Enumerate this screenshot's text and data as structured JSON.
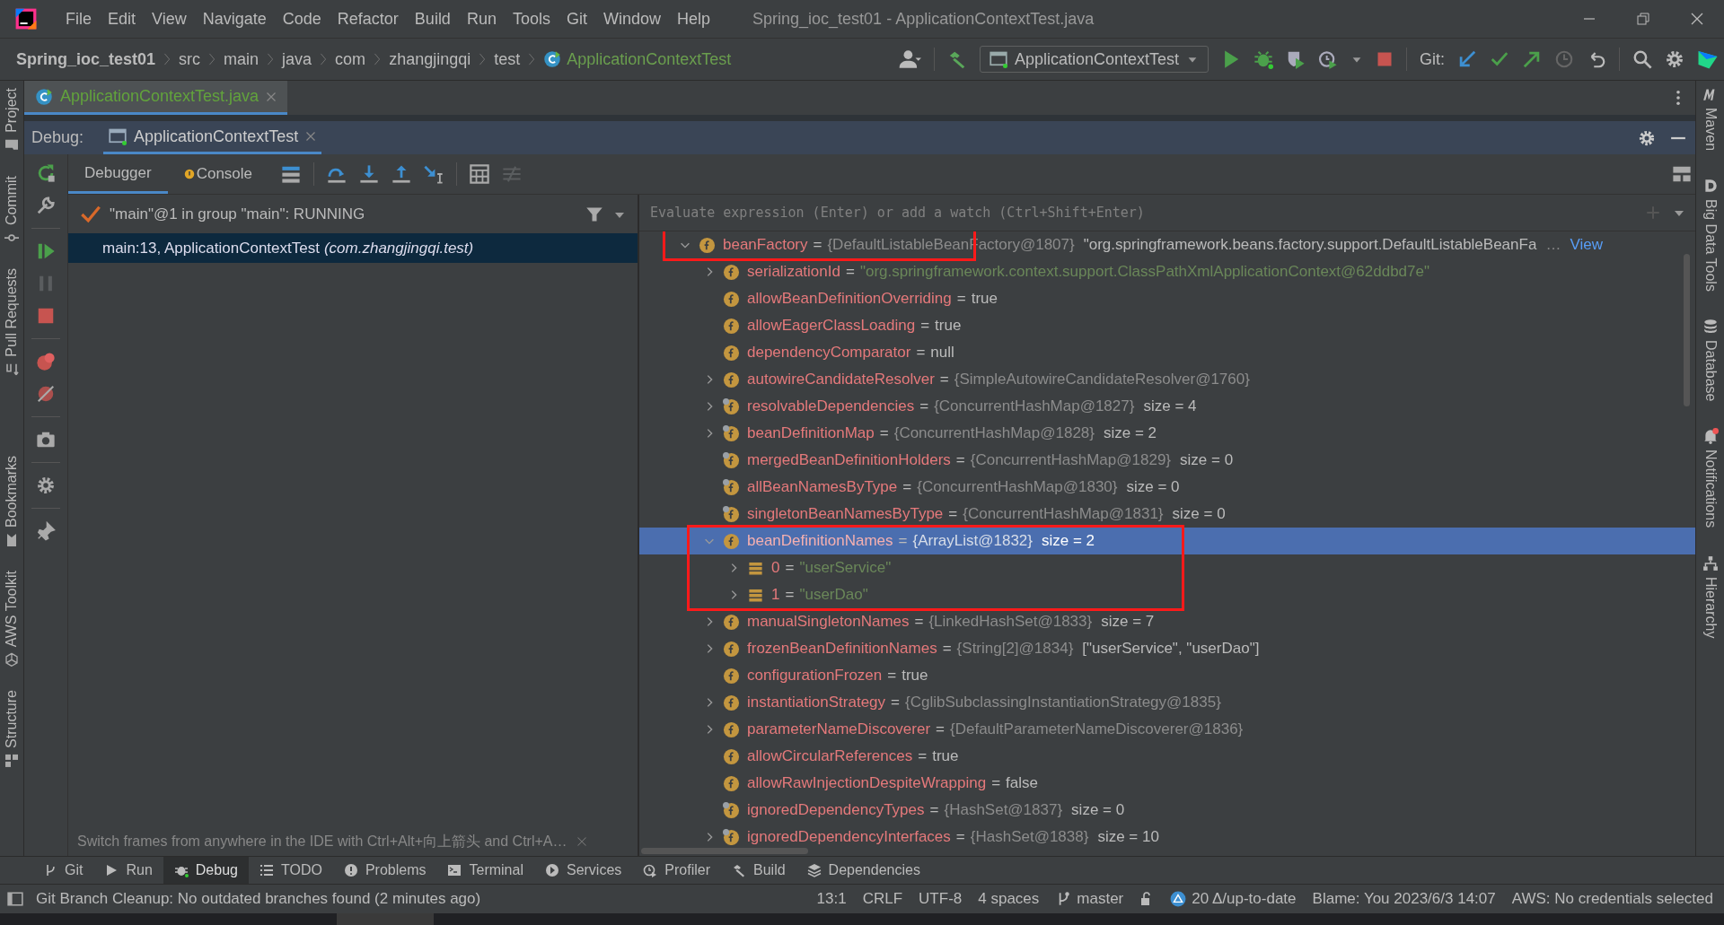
{
  "window": {
    "title": "Spring_ioc_test01 - ApplicationContextTest.java"
  },
  "menu": [
    "File",
    "Edit",
    "View",
    "Navigate",
    "Code",
    "Refactor",
    "Build",
    "Run",
    "Tools",
    "Git",
    "Window",
    "Help"
  ],
  "breadcrumbs": [
    {
      "label": "Spring_ioc_test01",
      "kind": "project"
    },
    {
      "label": "src",
      "kind": "dir"
    },
    {
      "label": "main",
      "kind": "dir"
    },
    {
      "label": "java",
      "kind": "dir"
    },
    {
      "label": "com",
      "kind": "dir"
    },
    {
      "label": "zhangjingqi",
      "kind": "dir"
    },
    {
      "label": "test",
      "kind": "dir"
    },
    {
      "label": "ApplicationContextTest",
      "kind": "class"
    }
  ],
  "toolbar": {
    "run_config": "ApplicationContextTest",
    "git_label": "Git:"
  },
  "editor_tabs": [
    {
      "label": "ApplicationContextTest.java",
      "selected": true
    }
  ],
  "debug": {
    "label": "Debug:",
    "sessions": [
      {
        "label": "ApplicationContextTest",
        "selected": true
      }
    ],
    "tabs": [
      {
        "label": "Debugger",
        "selected": true
      },
      {
        "label": "Console",
        "selected": false
      }
    ],
    "thread": "\"main\"@1 in group \"main\": RUNNING",
    "frames": [
      {
        "text": "main:13, ApplicationContextTest *(com.zhangjingqi.test)*",
        "selected": true
      }
    ],
    "hint": "Switch frames from anywhere in the IDE with Ctrl+Alt+向上箭头 and Ctrl+A…",
    "evaluate": {
      "placeholder": "Evaluate expression (Enter) or add a watch (Ctrl+Shift+Enter)"
    },
    "variables": [
      {
        "name": "beanFactory",
        "op": "=",
        "kind": "field",
        "final": false,
        "expandable": true,
        "expanded": true,
        "selected": false,
        "outlined": true,
        "value": [
          {
            "kind": "ref",
            "text": "{DefaultListableBeanFactory@1807}"
          },
          {
            "kind": "plain",
            "text": "\"org.springframework.beans.factory.support.DefaultListableBeanFa"
          },
          {
            "kind": "ref",
            "text": "…"
          },
          {
            "kind": "link",
            "text": "View"
          }
        ],
        "children": [
          {
            "name": "serializationId",
            "op": "=",
            "kind": "field",
            "final": false,
            "expandable": true,
            "expanded": false,
            "selected": false,
            "outlined": false,
            "value": [
              {
                "kind": "string",
                "text": "\"org.springframework.context.support.ClassPathXmlApplicationContext@62ddbd7e\""
              }
            ]
          },
          {
            "name": "allowBeanDefinitionOverriding",
            "op": "=",
            "kind": "field",
            "final": false,
            "expandable": false,
            "expanded": false,
            "selected": false,
            "outlined": false,
            "value": [
              {
                "kind": "plain",
                "text": "true"
              }
            ]
          },
          {
            "name": "allowEagerClassLoading",
            "op": "=",
            "kind": "field",
            "final": false,
            "expandable": false,
            "expanded": false,
            "selected": false,
            "outlined": false,
            "value": [
              {
                "kind": "plain",
                "text": "true"
              }
            ]
          },
          {
            "name": "dependencyComparator",
            "op": "=",
            "kind": "field",
            "final": false,
            "expandable": false,
            "expanded": false,
            "selected": false,
            "outlined": false,
            "value": [
              {
                "kind": "plain",
                "text": "null"
              }
            ]
          },
          {
            "name": "autowireCandidateResolver",
            "op": "=",
            "kind": "field",
            "final": false,
            "expandable": true,
            "expanded": false,
            "selected": false,
            "outlined": false,
            "value": [
              {
                "kind": "ref",
                "text": "{SimpleAutowireCandidateResolver@1760}"
              }
            ]
          },
          {
            "name": "resolvableDependencies",
            "op": "=",
            "kind": "field",
            "final": true,
            "expandable": true,
            "expanded": false,
            "selected": false,
            "outlined": false,
            "value": [
              {
                "kind": "ref",
                "text": "{ConcurrentHashMap@1827}"
              },
              {
                "kind": "plain",
                "text": "size = 4"
              }
            ]
          },
          {
            "name": "beanDefinitionMap",
            "op": "=",
            "kind": "field",
            "final": true,
            "expandable": true,
            "expanded": false,
            "selected": false,
            "outlined": false,
            "value": [
              {
                "kind": "ref",
                "text": "{ConcurrentHashMap@1828}"
              },
              {
                "kind": "plain",
                "text": "size = 2"
              }
            ]
          },
          {
            "name": "mergedBeanDefinitionHolders",
            "op": "=",
            "kind": "field",
            "final": true,
            "expandable": false,
            "expanded": false,
            "selected": false,
            "outlined": false,
            "value": [
              {
                "kind": "ref",
                "text": "{ConcurrentHashMap@1829}"
              },
              {
                "kind": "plain",
                "text": "size = 0"
              }
            ]
          },
          {
            "name": "allBeanNamesByType",
            "op": "=",
            "kind": "field",
            "final": true,
            "expandable": false,
            "expanded": false,
            "selected": false,
            "outlined": false,
            "value": [
              {
                "kind": "ref",
                "text": "{ConcurrentHashMap@1830}"
              },
              {
                "kind": "plain",
                "text": "size = 0"
              }
            ]
          },
          {
            "name": "singletonBeanNamesByType",
            "op": "=",
            "kind": "field",
            "final": true,
            "expandable": false,
            "expanded": false,
            "selected": false,
            "outlined": false,
            "value": [
              {
                "kind": "ref",
                "text": "{ConcurrentHashMap@1831}"
              },
              {
                "kind": "plain",
                "text": "size = 0"
              }
            ]
          },
          {
            "name": "beanDefinitionNames",
            "op": "=",
            "kind": "field",
            "final": false,
            "expandable": true,
            "expanded": true,
            "selected": true,
            "outlined": true,
            "value": [
              {
                "kind": "ref",
                "text": "{ArrayList@1832}"
              },
              {
                "kind": "plain",
                "text": "size = 2"
              }
            ],
            "children": [
              {
                "name": "0",
                "op": "=",
                "kind": "element",
                "final": false,
                "expandable": true,
                "expanded": false,
                "selected": false,
                "outlined": true,
                "value": [
                  {
                    "kind": "string",
                    "text": "\"userService\""
                  }
                ]
              },
              {
                "name": "1",
                "op": "=",
                "kind": "element",
                "final": false,
                "expandable": true,
                "expanded": false,
                "selected": false,
                "outlined": true,
                "value": [
                  {
                    "kind": "string",
                    "text": "\"userDao\""
                  }
                ]
              }
            ]
          },
          {
            "name": "manualSingletonNames",
            "op": "=",
            "kind": "field",
            "final": false,
            "expandable": true,
            "expanded": false,
            "selected": false,
            "outlined": false,
            "value": [
              {
                "kind": "ref",
                "text": "{LinkedHashSet@1833}"
              },
              {
                "kind": "plain",
                "text": "size = 7"
              }
            ]
          },
          {
            "name": "frozenBeanDefinitionNames",
            "op": "=",
            "kind": "field",
            "final": false,
            "expandable": true,
            "expanded": false,
            "selected": false,
            "outlined": false,
            "value": [
              {
                "kind": "ref",
                "text": "{String[2]@1834}"
              },
              {
                "kind": "plain",
                "text": "[\"userService\", \"userDao\"]"
              }
            ]
          },
          {
            "name": "configurationFrozen",
            "op": "=",
            "kind": "field",
            "final": false,
            "expandable": false,
            "expanded": false,
            "selected": false,
            "outlined": false,
            "value": [
              {
                "kind": "plain",
                "text": "true"
              }
            ]
          },
          {
            "name": "instantiationStrategy",
            "op": "=",
            "kind": "field",
            "final": false,
            "expandable": true,
            "expanded": false,
            "selected": false,
            "outlined": false,
            "value": [
              {
                "kind": "ref",
                "text": "{CglibSubclassingInstantiationStrategy@1835}"
              }
            ]
          },
          {
            "name": "parameterNameDiscoverer",
            "op": "=",
            "kind": "field",
            "final": false,
            "expandable": true,
            "expanded": false,
            "selected": false,
            "outlined": false,
            "value": [
              {
                "kind": "ref",
                "text": "{DefaultParameterNameDiscoverer@1836}"
              }
            ]
          },
          {
            "name": "allowCircularReferences",
            "op": "=",
            "kind": "field",
            "final": false,
            "expandable": false,
            "expanded": false,
            "selected": false,
            "outlined": false,
            "value": [
              {
                "kind": "plain",
                "text": "true"
              }
            ]
          },
          {
            "name": "allowRawInjectionDespiteWrapping",
            "op": "=",
            "kind": "field",
            "final": false,
            "expandable": false,
            "expanded": false,
            "selected": false,
            "outlined": false,
            "value": [
              {
                "kind": "plain",
                "text": "false"
              }
            ]
          },
          {
            "name": "ignoredDependencyTypes",
            "op": "=",
            "kind": "field",
            "final": true,
            "expandable": false,
            "expanded": false,
            "selected": false,
            "outlined": false,
            "value": [
              {
                "kind": "ref",
                "text": "{HashSet@1837}"
              },
              {
                "kind": "plain",
                "text": "size = 0"
              }
            ]
          },
          {
            "name": "ignoredDependencyInterfaces",
            "op": "=",
            "kind": "field",
            "final": true,
            "expandable": true,
            "expanded": false,
            "selected": false,
            "outlined": false,
            "value": [
              {
                "kind": "ref",
                "text": "{HashSet@1838}"
              },
              {
                "kind": "plain",
                "text": "size = 10"
              }
            ]
          }
        ]
      }
    ]
  },
  "left_stripe": [
    "Project",
    "Commit",
    "Pull Requests",
    "Bookmarks",
    "AWS Toolkit",
    "Structure"
  ],
  "right_stripe": [
    "Maven",
    "Big Data Tools",
    "Database",
    "Notifications",
    "Hierarchy"
  ],
  "tool_windows": [
    {
      "label": "Git",
      "selected": false
    },
    {
      "label": "Run",
      "selected": false
    },
    {
      "label": "Debug",
      "selected": true
    },
    {
      "label": "TODO",
      "selected": false
    },
    {
      "label": "Problems",
      "selected": false
    },
    {
      "label": "Terminal",
      "selected": false
    },
    {
      "label": "Services",
      "selected": false
    },
    {
      "label": "Profiler",
      "selected": false
    },
    {
      "label": "Build",
      "selected": false
    },
    {
      "label": "Dependencies",
      "selected": false
    }
  ],
  "status_bar": {
    "message": "Git Branch Cleanup: No outdated branches found (2 minutes ago)",
    "items": [
      "13:1",
      "CRLF",
      "UTF-8",
      "4 spaces",
      "master",
      "20 Δ/up-to-date",
      "Blame: You 2023/6/3 14:07",
      "AWS: No credentials selected"
    ]
  }
}
